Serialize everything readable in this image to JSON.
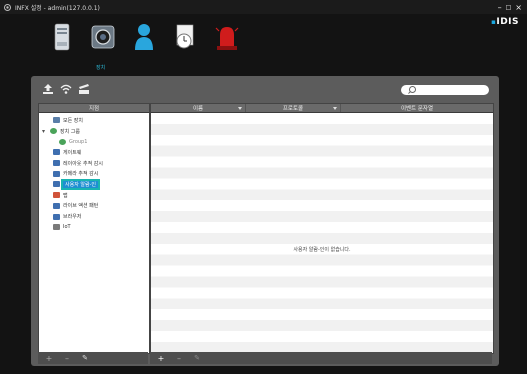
{
  "window": {
    "title": "INFX 설정 - admin(127.0.0.1)",
    "minimize": "–",
    "maximize": "□",
    "close": "×"
  },
  "brand": {
    "logo": "IDIS"
  },
  "top_icons": [
    {
      "icon": "server-icon"
    },
    {
      "icon": "camera-device-icon"
    },
    {
      "icon": "user-icon"
    },
    {
      "icon": "schedule-icon"
    },
    {
      "icon": "alarm-siren-icon"
    }
  ],
  "selected_section_label": "장치",
  "toolbar": {
    "icons": [
      "upload-icon",
      "wifi-scan-icon",
      "edit-folder-icon"
    ],
    "search_placeholder": ""
  },
  "tree": {
    "header": "지점",
    "items": [
      {
        "label": "모든 장치",
        "icon": "all-devices-icon",
        "color": "#5a7ea8"
      },
      {
        "label": "장치 그룹",
        "icon": "device-group-icon",
        "color": "#4aa35a",
        "expand": "▾"
      },
      {
        "label": "Group1",
        "icon": "group-icon",
        "color": "#4aa35a"
      },
      {
        "label": "게이트웨",
        "icon": "gateway-icon",
        "color": "#3f6fb0"
      },
      {
        "label": "레이아웃 추적 감시",
        "icon": "layout-monitor-icon",
        "color": "#3f6fb0"
      },
      {
        "label": "카메라 추적 감시",
        "icon": "camera-monitor-icon",
        "color": "#3f6fb0"
      },
      {
        "label": "사용자 알람-인",
        "icon": "user-alarm-icon",
        "color": "#3f6fb0",
        "selected": true
      },
      {
        "label": "맵",
        "icon": "map-icon",
        "color": "#d0533a"
      },
      {
        "label": "라이브 액션 패턴",
        "icon": "live-action-icon",
        "color": "#3f6fb0"
      },
      {
        "label": "브라우저",
        "icon": "browser-icon",
        "color": "#3f6fb0"
      },
      {
        "label": "IoT",
        "icon": "iot-icon",
        "color": "#7a7a7a"
      }
    ],
    "footer": {
      "add": "+",
      "remove": "–",
      "edit": "✎"
    }
  },
  "table": {
    "columns": [
      "이름",
      "프로토콜",
      "이벤트 문자열"
    ],
    "empty_message": "사용자 알람-인이 없습니다.",
    "footer": {
      "add": "+",
      "remove": "–",
      "edit": "✎"
    }
  },
  "colors": {
    "accent": "#2cb7d4",
    "selection": "#1e8fd2",
    "panel": "#5c5c5c"
  }
}
